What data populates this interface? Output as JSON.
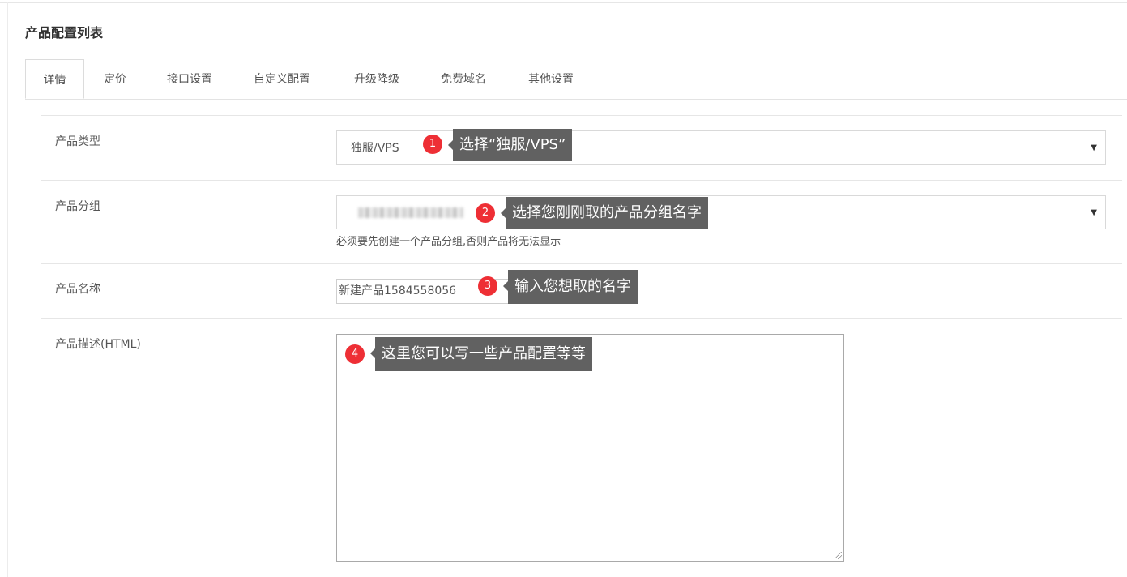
{
  "page_title": "产品配置列表",
  "tabs": [
    {
      "label": "详情",
      "active": true
    },
    {
      "label": "定价",
      "active": false
    },
    {
      "label": "接口设置",
      "active": false
    },
    {
      "label": "自定义配置",
      "active": false
    },
    {
      "label": "升级降级",
      "active": false
    },
    {
      "label": "免费域名",
      "active": false
    },
    {
      "label": "其他设置",
      "active": false
    }
  ],
  "form": {
    "product_type": {
      "label": "产品类型",
      "value": "独服/VPS"
    },
    "product_group": {
      "label": "产品分组",
      "value": "",
      "help": "必须要先创建一个产品分组,否则产品将无法显示"
    },
    "product_name": {
      "label": "产品名称",
      "value": "新建产品1584558056"
    },
    "product_desc": {
      "label": "产品描述(HTML)",
      "value": ""
    }
  },
  "annotations": [
    {
      "number": "1",
      "text": "选择“独服/VPS”"
    },
    {
      "number": "2",
      "text": "选择您刚刚取的产品分组名字"
    },
    {
      "number": "3",
      "text": "输入您想取的名字"
    },
    {
      "number": "4",
      "text": "这里您可以写一些产品配置等等"
    }
  ],
  "icons": {
    "select_caret": "caret-down-icon",
    "resize": "resize-handle-icon"
  },
  "colors": {
    "badge": "#ee2f35",
    "tooltip_bg": "#616161"
  }
}
